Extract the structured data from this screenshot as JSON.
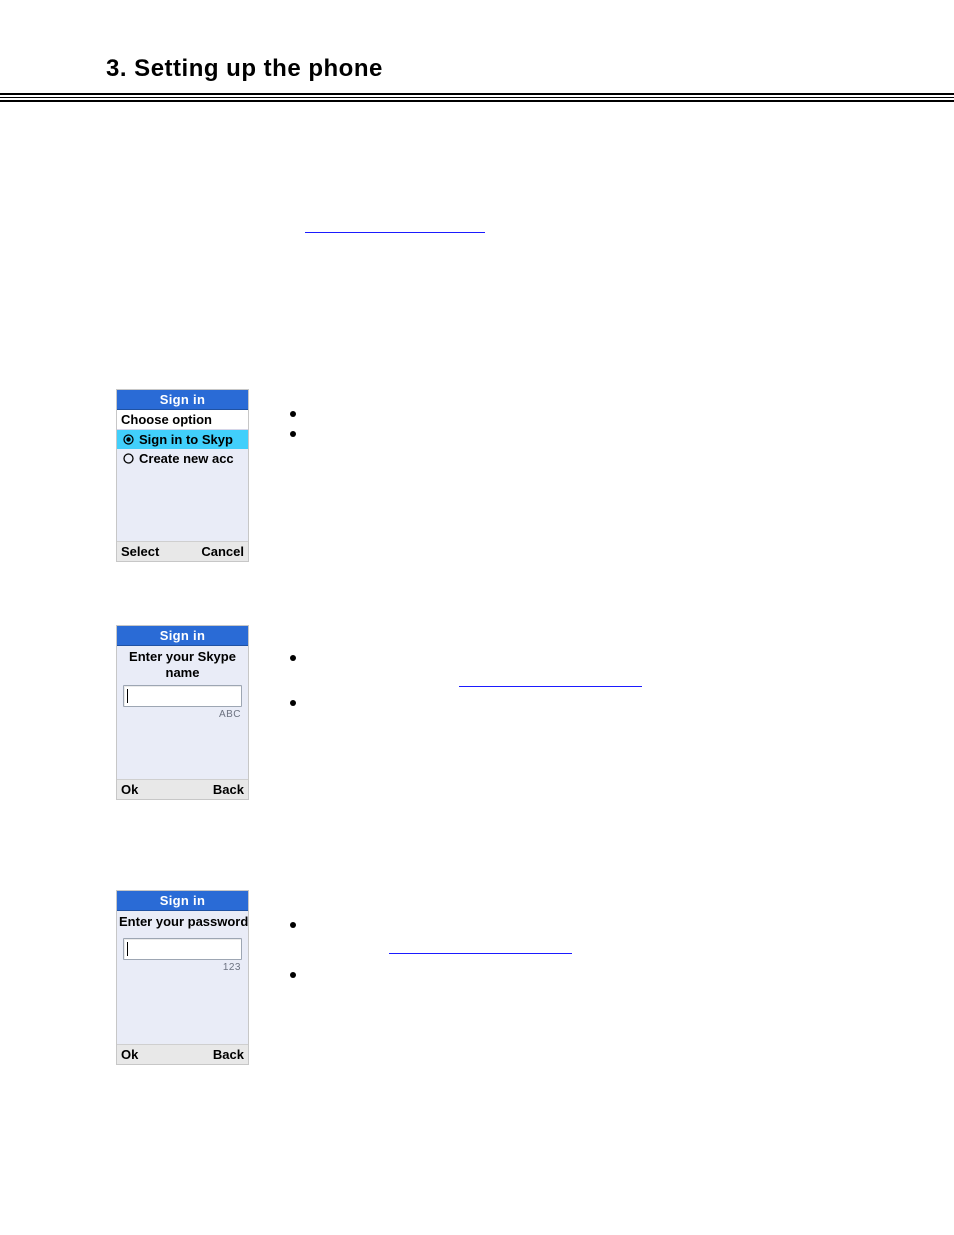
{
  "heading": "3. Setting up the phone",
  "phone1": {
    "title": "Sign in",
    "choose": "Choose option",
    "opt_selected": "Sign in to Skyp",
    "opt_other": "Create new acc",
    "soft_left": "Select",
    "soft_right": "Cancel"
  },
  "phone2": {
    "title": "Sign in",
    "prompt": "Enter your Skype name",
    "mode": "ABC",
    "soft_left": "Ok",
    "soft_right": "Back"
  },
  "phone3": {
    "title": "Sign in",
    "prompt": "Enter your password",
    "mode": "123",
    "soft_left": "Ok",
    "soft_right": "Back"
  }
}
